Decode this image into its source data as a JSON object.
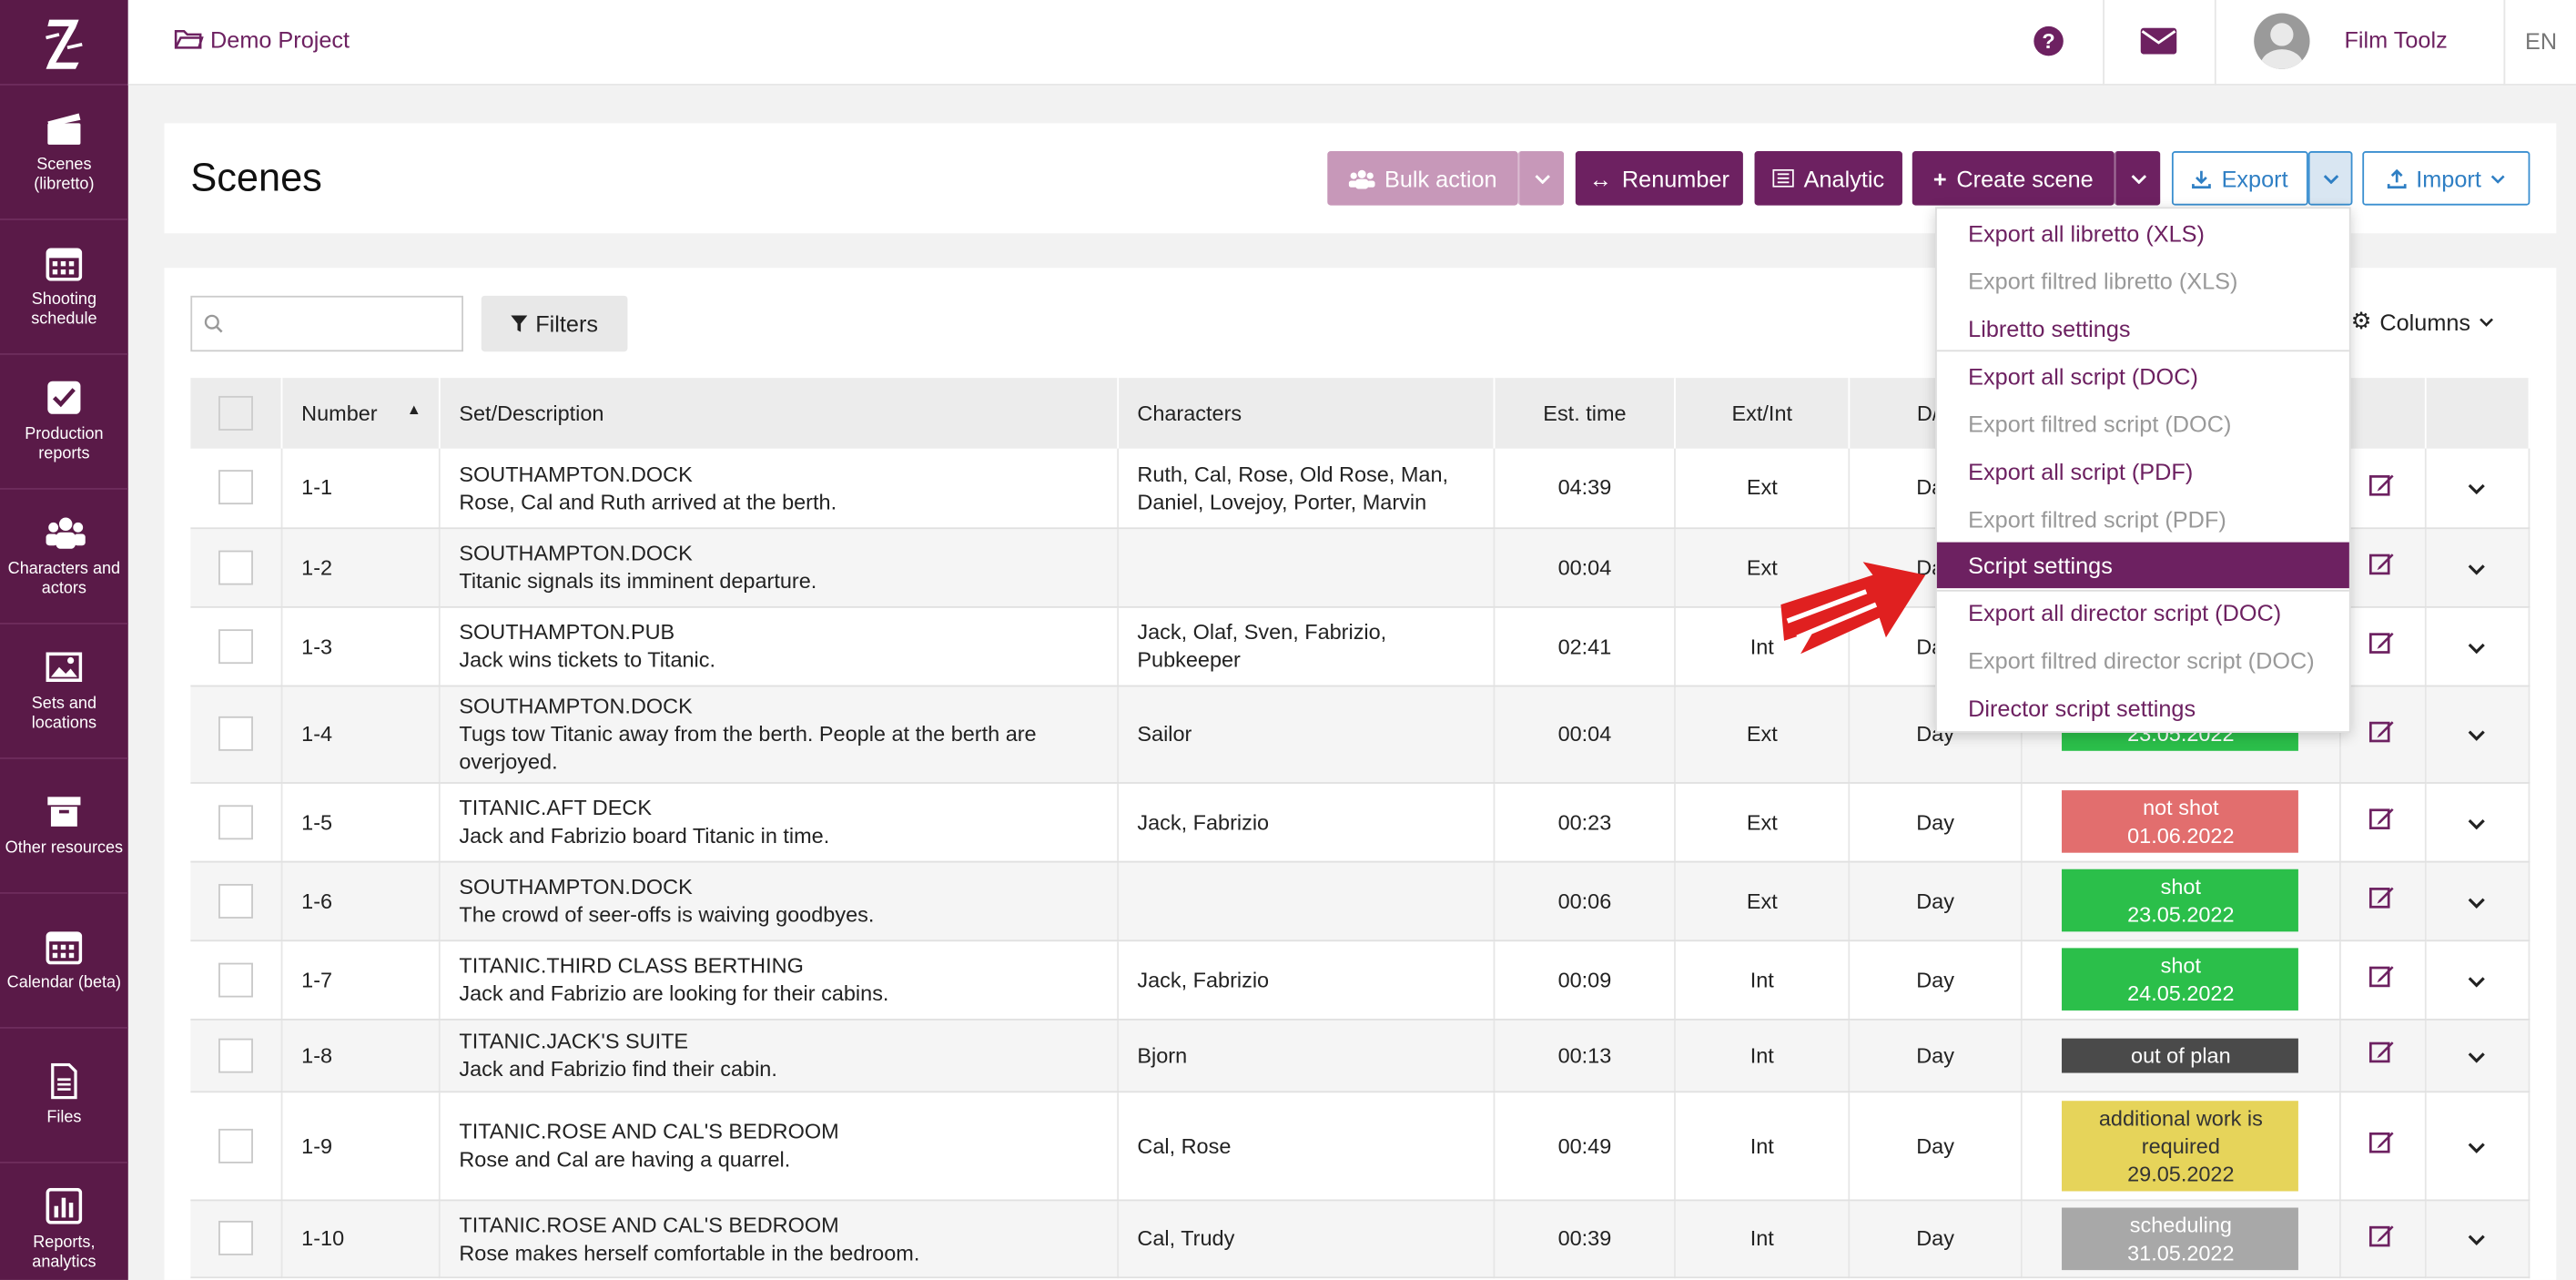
{
  "sidebar": {
    "logo": "Z",
    "items": [
      {
        "label": "Scenes (libretto)",
        "icon": "clapperboard-icon"
      },
      {
        "label": "Shooting schedule",
        "icon": "calendar-icon"
      },
      {
        "label": "Production reports",
        "icon": "checkbox-icon"
      },
      {
        "label": "Characters and actors",
        "icon": "users-icon"
      },
      {
        "label": "Sets and locations",
        "icon": "image-icon"
      },
      {
        "label": "Other resources",
        "icon": "archive-icon"
      },
      {
        "label": "Calendar (beta)",
        "icon": "calendar-icon"
      },
      {
        "label": "Files",
        "icon": "file-icon"
      },
      {
        "label": "Reports, analytics",
        "icon": "bar-chart-icon"
      }
    ]
  },
  "topbar": {
    "project": "Demo Project",
    "username": "Film Toolz",
    "language": "EN"
  },
  "header": {
    "title": "Scenes",
    "bulk_action": "Bulk action",
    "renumber": "Renumber",
    "analytic": "Analytic",
    "create_scene": "Create scene",
    "export": "Export",
    "import": "Import"
  },
  "toolbar": {
    "search_placeholder": "",
    "filters": "Filters",
    "columns": "Columns"
  },
  "table": {
    "headers": [
      "Number",
      "Set/Description",
      "Characters",
      "Est. time",
      "Ext/Int",
      "D/N"
    ],
    "rows": [
      {
        "number": "1-1",
        "set": "SOUTHAMPTON.DOCK",
        "desc": "Rose, Cal and Ruth arrived at the berth.",
        "chars": "Ruth, Cal, Rose, Old Rose, Man, Daniel, Lovejoy, Porter, Marvin",
        "time": "04:39",
        "extint": "Ext",
        "dn": "Day",
        "status": "",
        "status_date": "",
        "status_color": ""
      },
      {
        "number": "1-2",
        "set": "SOUTHAMPTON.DOCK",
        "desc": "Titanic signals its imminent departure.",
        "chars": "",
        "time": "00:04",
        "extint": "Ext",
        "dn": "Day",
        "status": "",
        "status_date": "",
        "status_color": ""
      },
      {
        "number": "1-3",
        "set": "SOUTHAMPTON.PUB",
        "desc": "Jack wins tickets to Titanic.",
        "chars": "Jaсk, Olaf, Sven, Fabrizio, Pubkeeper",
        "time": "02:41",
        "extint": "Int",
        "dn": "Day",
        "status": "",
        "status_date": "",
        "status_color": ""
      },
      {
        "number": "1-4",
        "set": "SOUTHAMPTON.DOCK",
        "desc": "Tugs tow Titanic away from the berth. People at the berth are overjoyed.",
        "chars": "Sailor",
        "time": "00:04",
        "extint": "Ext",
        "dn": "Day",
        "status": "",
        "status_date": "23.05.2022",
        "status_color": "#2bbf4a"
      },
      {
        "number": "1-5",
        "set": "TITANIC.AFT DECK",
        "desc": "Jack and Fabrizio board Titanic in time.",
        "chars": "Jaсk, Fabrizio",
        "time": "00:23",
        "extint": "Ext",
        "dn": "Day",
        "status": "not shot",
        "status_date": "01.06.2022",
        "status_color": "#e26e6e"
      },
      {
        "number": "1-6",
        "set": "SOUTHAMPTON.DOCK",
        "desc": "The crowd of seer-offs is waiving goodbyes.",
        "chars": "",
        "time": "00:06",
        "extint": "Ext",
        "dn": "Day",
        "status": "shot",
        "status_date": "23.05.2022",
        "status_color": "#2bbf4a"
      },
      {
        "number": "1-7",
        "set": "TITANIC.THIRD CLASS BERTHING",
        "desc": "Jack and Fabrizio are looking for their cabins.",
        "chars": "Jaсk, Fabrizio",
        "time": "00:09",
        "extint": "Int",
        "dn": "Day",
        "status": "shot",
        "status_date": "24.05.2022",
        "status_color": "#2bbf4a"
      },
      {
        "number": "1-8",
        "set": "TITANIC.JACK'S SUITE",
        "desc": "Jack and Fabrizio find their cabin.",
        "chars": "Bjorn",
        "time": "00:13",
        "extint": "Int",
        "dn": "Day",
        "status": "out of plan",
        "status_date": "",
        "status_color": "#4a4a4a"
      },
      {
        "number": "1-9",
        "set": "TITANIC.ROSE AND CAL'S BEDROOM",
        "desc": "Rose and Cal are having a quarrel.",
        "chars": "Cal, Rose",
        "time": "00:49",
        "extint": "Int",
        "dn": "Day",
        "status": "additional work is required",
        "status_date": "29.05.2022",
        "status_color": "#e6d45a"
      },
      {
        "number": "1-10",
        "set": "TITANIC.ROSE AND CAL'S BEDROOM",
        "desc": "Rose makes herself comfortable in the bedroom.",
        "chars": "Cal, Trudy",
        "time": "00:39",
        "extint": "Int",
        "dn": "Day",
        "status": "scheduling",
        "status_date": "31.05.2022",
        "status_color": "#a8a8a8"
      }
    ]
  },
  "export_menu": {
    "items": [
      {
        "label": "Export all libretto (XLS)",
        "state": "normal"
      },
      {
        "label": "Export filtred libretto (XLS)",
        "state": "disabled"
      },
      {
        "label": "Libretto settings",
        "state": "normal"
      },
      {
        "label": "Export all script (DOC)",
        "state": "normal"
      },
      {
        "label": "Export filtred script (DOC)",
        "state": "disabled"
      },
      {
        "label": "Export all script (PDF)",
        "state": "normal"
      },
      {
        "label": "Export filtred script (PDF)",
        "state": "disabled"
      },
      {
        "label": "Script settings",
        "state": "active"
      },
      {
        "label": "Export all director script (DOC)",
        "state": "normal"
      },
      {
        "label": "Export filtred director script (DOC)",
        "state": "disabled"
      },
      {
        "label": "Director script settings",
        "state": "normal"
      }
    ]
  },
  "colors": {
    "brand": "#6d2161",
    "sidebar": "#5a1a48",
    "export_blue": "#2f7fc4",
    "arrow_red": "#e02020"
  }
}
